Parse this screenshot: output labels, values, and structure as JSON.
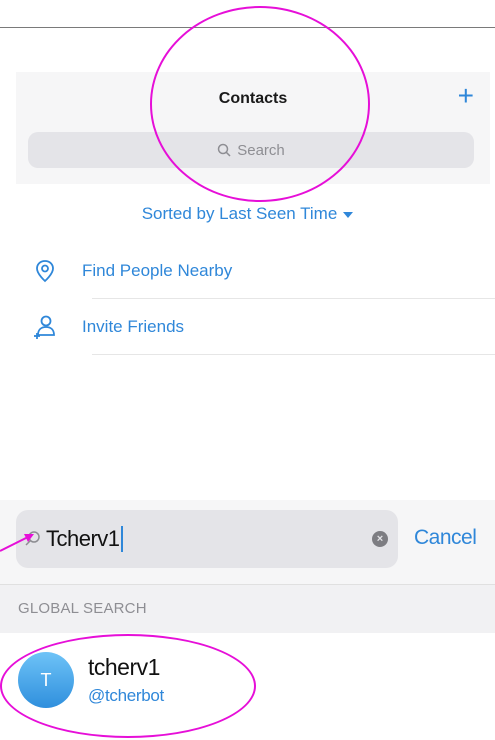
{
  "contacts": {
    "title": "Contacts",
    "add_icon": "plus-icon",
    "search_placeholder": "Search",
    "sort_label": "Sorted by Last Seen Time",
    "rows": [
      {
        "label": "Find People Nearby",
        "icon": "location-pin-icon"
      },
      {
        "label": "Invite Friends",
        "icon": "add-person-icon"
      }
    ]
  },
  "search": {
    "query": "Tcherv1",
    "cancel_label": "Cancel",
    "section_header": "GLOBAL SEARCH",
    "results": [
      {
        "avatar_initial": "T",
        "name": "tcherv1",
        "username": "@tcherbot"
      }
    ]
  },
  "colors": {
    "accent": "#2f87d9",
    "annotation": "#e60fd8",
    "panel_bg": "#f6f6f7"
  }
}
